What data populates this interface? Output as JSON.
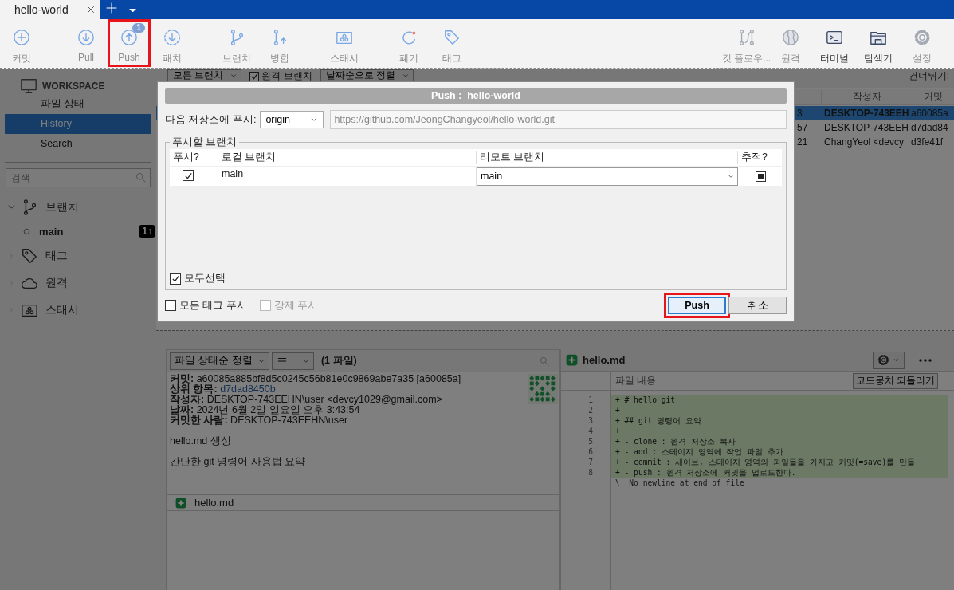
{
  "tab_bar": {
    "tabs": [
      {
        "label": "hello-world",
        "selected": true
      }
    ]
  },
  "toolbar": {
    "groups": [
      [
        {
          "label": "커밋",
          "disabled": true,
          "highlighted": false
        }
      ],
      [
        {
          "label": "Pull",
          "disabled": true,
          "highlighted": false
        },
        {
          "label": "Push",
          "disabled": true,
          "highlighted": true,
          "badge": "1"
        },
        {
          "label": "패치",
          "disabled": true,
          "highlighted": false
        }
      ],
      [
        {
          "label": "브랜치",
          "disabled": true,
          "highlighted": false
        },
        {
          "label": "병합",
          "disabled": true,
          "highlighted": false
        }
      ],
      [
        {
          "label": "스태시",
          "disabled": true,
          "highlighted": false
        }
      ],
      [
        {
          "label": "폐기",
          "disabled": true,
          "highlighted": false
        },
        {
          "label": "태그",
          "disabled": true,
          "highlighted": false
        }
      ]
    ],
    "right": [
      {
        "label": "깃 플로우...",
        "disabled": true,
        "highlighted": false
      },
      {
        "label": "원격",
        "disabled": true,
        "highlighted": false
      },
      {
        "label": "터미널",
        "disabled": false,
        "highlighted": false
      },
      {
        "label": "탐색기",
        "disabled": false,
        "highlighted": false
      },
      {
        "label": "설정",
        "disabled": true,
        "highlighted": false
      }
    ]
  },
  "sidebar": {
    "workspace": {
      "title": "WORKSPACE",
      "items": [
        {
          "label": "파일 상태",
          "selected": false
        },
        {
          "label": "History",
          "selected": true
        },
        {
          "label": "Search",
          "selected": false
        }
      ]
    },
    "search": {
      "placeholder": "검색"
    },
    "tree": [
      {
        "label": "브랜치",
        "expanded": true,
        "children": [
          {
            "label": "main",
            "badge": "1↑"
          }
        ]
      },
      {
        "label": "태그",
        "expanded": false
      },
      {
        "label": "원격",
        "expanded": false
      },
      {
        "label": "스태시",
        "expanded": false
      }
    ]
  },
  "history": {
    "filters": [
      {
        "kind": "dropdown",
        "label": "모든 브랜치"
      },
      {
        "kind": "checkbox",
        "label": "원격 브랜치",
        "checked": true
      },
      {
        "kind": "dropdown",
        "label": "날짜순으로 정렬"
      }
    ],
    "skip_label": "건너뛰기:",
    "columns": {
      "author": "작성자",
      "commit": "커밋"
    },
    "rows": [
      {
        "column_1": "3",
        "author": "DESKTOP-743EEH",
        "commit": "a60085a",
        "selected": true
      },
      {
        "column_1": "57",
        "author": "DESKTOP-743EEH",
        "commit": "d7dad84",
        "selected": false
      },
      {
        "column_1": "21",
        "author": "ChangYeol <devcy",
        "commit": "d3fe41f",
        "selected": false
      }
    ]
  },
  "commit_panel": {
    "sort": "파일 상태순 정렬",
    "count": "(1 파일)",
    "details": [
      {
        "kind": "text",
        "label": "커밋:",
        "value": "a60085a885bf8d5c0245c56b81e0c9869abe7a35 [a60085a]"
      },
      {
        "kind": "link",
        "label": "상위 항목:",
        "value": "d7dad8450b"
      },
      {
        "kind": "text",
        "label": "작성자:",
        "value": "DESKTOP-743EEHN\\user <devcy1029@gmail.com>"
      },
      {
        "kind": "text",
        "label": "날짜:",
        "value": "2024년 6월 2일 일요일 오후 3:43:54"
      },
      {
        "kind": "text",
        "label": "커밋한 사람:",
        "value": "DESKTOP-743EEHN\\user"
      }
    ],
    "message": [
      "hello.md 생성",
      "간단한 git 명령어 사용법 요약"
    ],
    "files": [
      {
        "name": "hello.md"
      }
    ]
  },
  "diff": {
    "file": {
      "name": "hello.md"
    },
    "hunk_title": "파일 내용",
    "revert": "코드뭉치 되돌리기",
    "lines": [
      {
        "kind": "added",
        "number": "1",
        "text": "+ # hello git"
      },
      {
        "kind": "added",
        "number": "2",
        "text": "+"
      },
      {
        "kind": "added",
        "number": "3",
        "text": "+ ## git 명령어 요약"
      },
      {
        "kind": "added",
        "number": "4",
        "text": "+"
      },
      {
        "kind": "added",
        "number": "5",
        "text": "+ - clone : 원격 저장소 복사"
      },
      {
        "kind": "added",
        "number": "6",
        "text": "+ - add : 스테이지 영역에 작업 파일 추가"
      },
      {
        "kind": "added",
        "number": "7",
        "text": "+ - commit : 세이브, 스테이지 영역의 파일들을 가지고 커밋(=save)를 만들"
      },
      {
        "kind": "added",
        "number": "8",
        "text": "+ - push : 원격 저장소에 커밋을 업로드한다."
      },
      {
        "kind": "note",
        "text": "\\  No newline at end of file"
      }
    ]
  },
  "dialog": {
    "title": "Push :  hello-world",
    "remote_label": "다음 저장소에 푸시:",
    "remote": "origin",
    "url": "https://github.com/JeongChangyeol/hello-world.git",
    "group": "푸시할 브랜치",
    "columns": [
      "푸시?",
      "로컬 브랜치",
      "리모트 브랜치",
      "추적?"
    ],
    "branches": [
      {
        "push": true,
        "local": "main",
        "remote": "main",
        "track": true
      }
    ],
    "select_all": {
      "label": "모두선택",
      "checked": true
    },
    "options": [
      {
        "label": "모든 태그 푸시",
        "checked": false,
        "disabled": false
      },
      {
        "label": "강제 푸시",
        "checked": false,
        "disabled": true
      }
    ],
    "buttons": [
      {
        "label": "Push",
        "default": true,
        "highlighted": true
      },
      {
        "label": "취소",
        "default": false,
        "highlighted": false
      }
    ]
  }
}
